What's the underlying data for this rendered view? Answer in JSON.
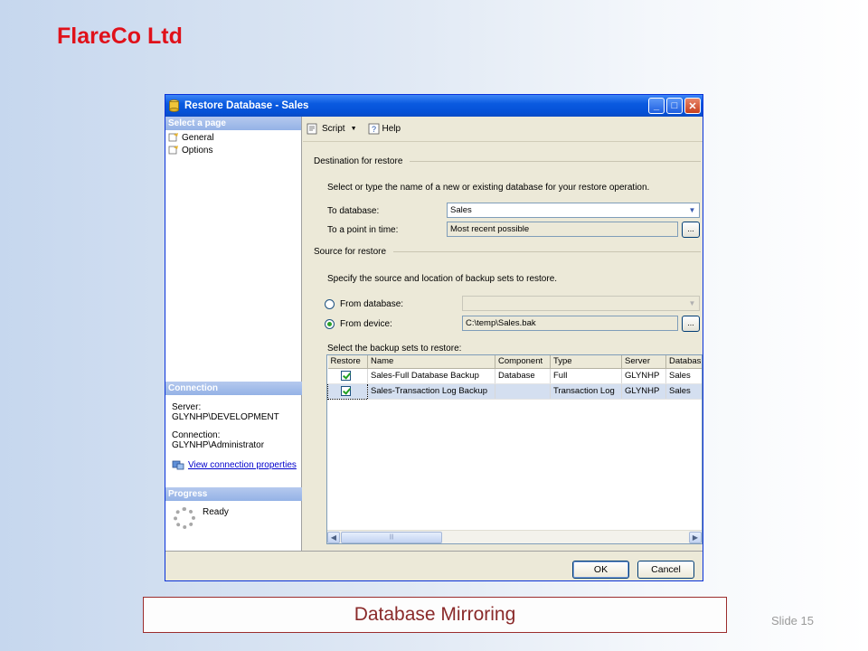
{
  "slide": {
    "company": "FlareCo Ltd",
    "caption": "Database Mirroring",
    "slide_number": "Slide 15",
    "accent_color": "#e0111a"
  },
  "window": {
    "title": "Restore Database - Sales",
    "title_controls": [
      "minimize",
      "maximize",
      "close"
    ]
  },
  "left_pane": {
    "select_page_header": "Select a page",
    "pages": [
      {
        "label": "General",
        "icon": "page-icon"
      },
      {
        "label": "Options",
        "icon": "page-icon"
      }
    ],
    "connection_header": "Connection",
    "server_label": "Server:",
    "server_value": "GLYNHP\\DEVELOPMENT",
    "connection_label": "Connection:",
    "connection_value": "GLYNHP\\Administrator",
    "view_connection_link": "View connection properties",
    "progress_header": "Progress",
    "progress_status": "Ready"
  },
  "toolbar": {
    "script_label": "Script",
    "help_label": "Help"
  },
  "destination": {
    "header": "Destination for restore",
    "instructions": "Select or type the name of a new or existing database for your restore operation.",
    "to_database_label": "To database:",
    "to_database_value": "Sales",
    "point_in_time_label": "To a point in time:",
    "point_in_time_value": "Most recent possible",
    "ellipsis": "..."
  },
  "source": {
    "header": "Source for restore",
    "instructions": "Specify the source and location of backup sets to restore.",
    "from_database_label": "From database:",
    "from_database_value": "",
    "from_device_label": "From device:",
    "from_device_value": "C:\\temp\\Sales.bak",
    "selected_option": "From device:",
    "backup_sets_label": "Select the backup sets to restore:"
  },
  "backup_table": {
    "columns": [
      "Restore",
      "Name",
      "Component",
      "Type",
      "Server",
      "Databas"
    ],
    "rows": [
      {
        "restore": true,
        "name": "Sales-Full Database Backup",
        "component": "Database",
        "type": "Full",
        "server": "GLYNHP",
        "database": "Sales"
      },
      {
        "restore": true,
        "name": "Sales-Transaction Log  Backup",
        "component": "",
        "type": "Transaction Log",
        "server": "GLYNHP",
        "database": "Sales"
      }
    ],
    "selected_row": 1
  },
  "buttons": {
    "ok": "OK",
    "cancel": "Cancel"
  }
}
